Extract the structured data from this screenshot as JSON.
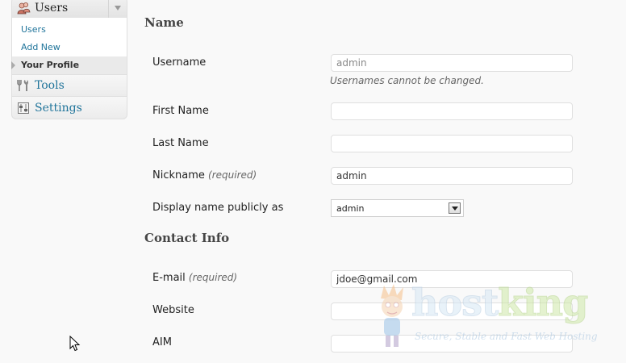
{
  "sidebar": {
    "users_menu": {
      "label": "Users",
      "icon": "users-icon",
      "submenu": [
        {
          "label": "Users",
          "current": false
        },
        {
          "label": "Add New",
          "current": false
        },
        {
          "label": "Your Profile",
          "current": true
        }
      ]
    },
    "items": [
      {
        "label": "Tools",
        "icon": "tools-icon"
      },
      {
        "label": "Settings",
        "icon": "settings-icon"
      }
    ]
  },
  "form": {
    "name_section_title": "Name",
    "username": {
      "label": "Username",
      "value": "admin",
      "note": "Usernames cannot be changed."
    },
    "first_name": {
      "label": "First Name",
      "value": ""
    },
    "last_name": {
      "label": "Last Name",
      "value": ""
    },
    "nickname": {
      "label": "Nickname",
      "required": "(required)",
      "value": "admin"
    },
    "display_name": {
      "label": "Display name publicly as",
      "selected": "admin"
    },
    "contact_section_title": "Contact Info",
    "email": {
      "label": "E-mail",
      "required": "(required)",
      "value": "jdoe@gmail.com"
    },
    "website": {
      "label": "Website",
      "value": ""
    },
    "aim": {
      "label": "AIM",
      "value": ""
    }
  },
  "watermark": {
    "brand_part1": "host",
    "brand_part2": "king",
    "tagline": "Secure, Stable and Fast Web Hosting"
  },
  "colors": {
    "link": "#21759b",
    "background": "#f9f9f9",
    "current_item_bg": "#eaeaea"
  }
}
